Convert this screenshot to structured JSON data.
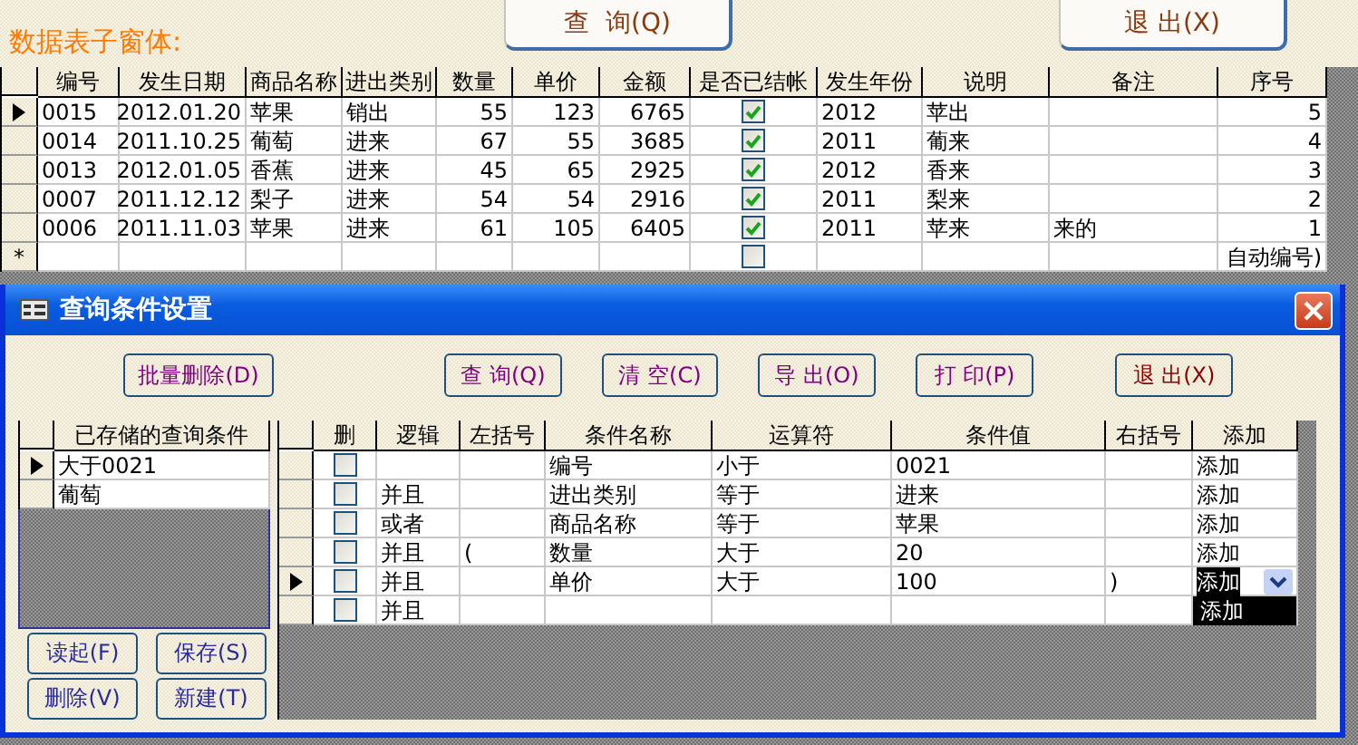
{
  "form_title": "数据表子窗体:",
  "top_buttons": [
    {
      "label": "查  询(Q)",
      "kind": "query"
    },
    {
      "label": "退 出(X)",
      "kind": "exit"
    }
  ],
  "records": {
    "columns": [
      "编号",
      "发生日期",
      "商品名称",
      "进出类别",
      "数量",
      "单价",
      "金额",
      "是否已结帐",
      "发生年份",
      "说明",
      "备注",
      "序号"
    ],
    "rows": [
      {
        "id": "0015",
        "date": "2012.01.20",
        "product": "苹果",
        "direction": "销出",
        "qty": "55",
        "price": "123",
        "amount": "6765",
        "settled": true,
        "year": "2012",
        "note": "苹出",
        "seq": "5",
        "current": true
      },
      {
        "id": "0014",
        "date": "2011.10.25",
        "product": "葡萄",
        "direction": "进来",
        "qty": "67",
        "price": "55",
        "amount": "3685",
        "settled": true,
        "year": "2011",
        "note": "葡来",
        "seq": "4",
        "current": false
      },
      {
        "id": "0013",
        "date": "2012.01.05",
        "product": "香蕉",
        "direction": "进来",
        "qty": "45",
        "price": "65",
        "amount": "2925",
        "settled": true,
        "year": "2012",
        "note": "香来",
        "seq": "3",
        "current": false
      },
      {
        "id": "0007",
        "date": "2011.12.12",
        "product": "梨子",
        "direction": "进来",
        "qty": "54",
        "price": "54",
        "amount": "2916",
        "settled": true,
        "year": "2011",
        "note": "梨来",
        "seq": "2",
        "current": false
      },
      {
        "id": "0006",
        "date": "2011.11.03",
        "product": "苹果",
        "direction": "进来",
        "qty": "61",
        "price": "105",
        "amount": "6405",
        "settled": true,
        "year": "2011",
        "note": "苹来",
        "remark": "来的",
        "seq": "1",
        "current": false
      }
    ],
    "new_row": {
      "marker": "*",
      "settled": false,
      "seq": "自动编号)"
    }
  },
  "dialog": {
    "title": "查询条件设置",
    "buttons": [
      {
        "label": "批量删除(D)",
        "kind": "normal"
      },
      {
        "label": "查 询(Q)",
        "kind": "normal"
      },
      {
        "label": "清 空(C)",
        "kind": "normal"
      },
      {
        "label": "导 出(O)",
        "kind": "normal"
      },
      {
        "label": "打 印(P)",
        "kind": "normal"
      },
      {
        "label": "退 出(X)",
        "kind": "exit"
      }
    ],
    "saved_queries": {
      "header": "已存储的查询条件",
      "items": [
        {
          "label": "大于0021",
          "current": true
        },
        {
          "label": "葡萄",
          "current": false
        }
      ]
    },
    "list_buttons": [
      "读起(F)",
      "保存(S)",
      "删除(V)",
      "新建(T)"
    ],
    "conditions": {
      "columns": [
        "删",
        "逻辑",
        "左括号",
        "条件名称",
        "运算符",
        "条件值",
        "右括号",
        "添加"
      ],
      "rows": [
        {
          "delete": false,
          "field": "编号",
          "operator": "小于",
          "value": "0021",
          "add": "添加",
          "current": false
        },
        {
          "delete": false,
          "logic": "并且",
          "field": "进出类别",
          "operator": "等于",
          "value": "进来",
          "add": "添加",
          "current": false
        },
        {
          "delete": false,
          "logic": "或者",
          "field": "商品名称",
          "operator": "等于",
          "value": "苹果",
          "add": "添加",
          "current": false
        },
        {
          "delete": false,
          "logic": "并且",
          "lparen": "(",
          "field": "数量",
          "operator": "大于",
          "value": "20",
          "add": "添加",
          "current": false
        },
        {
          "delete": false,
          "logic": "并且",
          "field": "单价",
          "operator": "大于",
          "value": "100",
          "rparen": ")",
          "add": "添加",
          "current": true,
          "dropdown_open": true,
          "options": [
            "添加"
          ]
        },
        {
          "delete": false,
          "logic": "并且",
          "current": false
        }
      ]
    }
  }
}
